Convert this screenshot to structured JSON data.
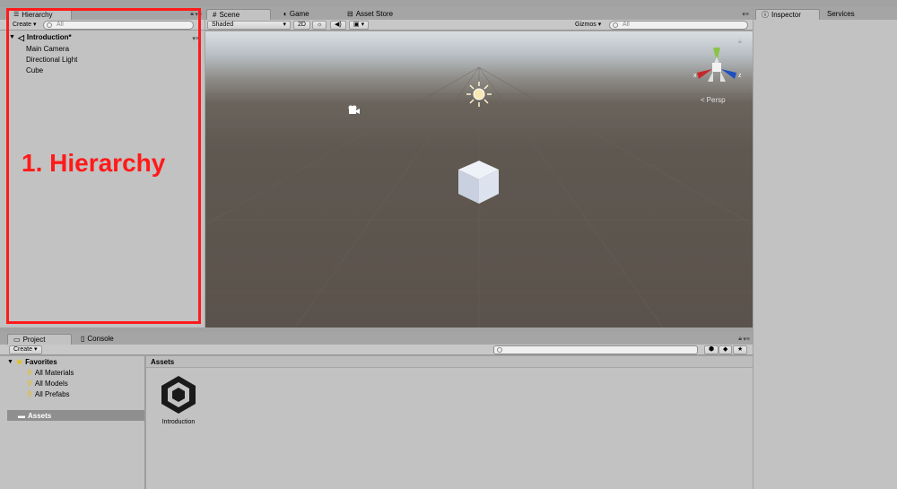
{
  "hierarchy": {
    "tab_label": "Hierarchy",
    "create_label": "Create",
    "search_placeholder": "All",
    "scene_name": "Introduction*",
    "items": [
      "Main Camera",
      "Directional Light",
      "Cube"
    ],
    "annotation": "1. Hierarchy",
    "annotation_color": "#ff1a1a"
  },
  "scene_tabs": {
    "scene": "Scene",
    "game": "Game",
    "asset_store": "Asset Store"
  },
  "scene_toolbar": {
    "shading_mode": "Shaded",
    "mode_2d": "2D",
    "gizmos_label": "Gizmos",
    "search_placeholder": "All"
  },
  "scene_view": {
    "persp_label": "Persp",
    "gizmo_x": "x",
    "gizmo_z": "z",
    "sky_color": "#c9d0d6",
    "ground_color": "#5a524b",
    "cube_color": "#cfd6e6"
  },
  "inspector": {
    "tab_label": "Inspector",
    "services_label": "Services"
  },
  "project": {
    "tab_label": "Project",
    "console_label": "Console",
    "create_label": "Create",
    "favorites_label": "Favorites",
    "favorites": [
      "All Materials",
      "All Models",
      "All Prefabs"
    ],
    "assets_folder": "Assets",
    "breadcrumb": "Assets",
    "asset_items": [
      {
        "label": "Introduction",
        "icon": "unity-icon"
      }
    ]
  }
}
